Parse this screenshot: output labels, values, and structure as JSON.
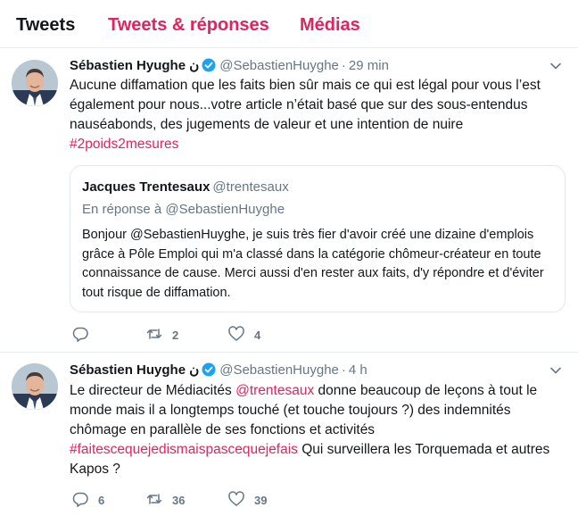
{
  "tabs": [
    "Tweets",
    "Tweets & réponses",
    "Médias"
  ],
  "colors": {
    "accent": "#e0245e",
    "verified": "#1da1f2",
    "muted": "#657786"
  },
  "tweets": [
    {
      "name": "Sébastien Hyughe",
      "name_suffix": " ن",
      "handle": "@SebastienHuyghe",
      "sep": "·",
      "time": "29 min",
      "lines": [
        "Aucune diffamation que les faits bien sûr mais ce qui est légal pour vous l’est",
        "également pour nous...votre article n’était basé que sur des sous-entendus",
        "nauséabonds, des jugements de valeur et une intention de nuire"
      ],
      "hashtag": "#2poids2mesures",
      "quote": {
        "name": "Jacques Trentesaux",
        "handle": "@trentesaux",
        "reply_to": "En réponse à @SebastienHuyghe",
        "text": "Bonjour @SebastienHuyghe, je suis très fier d'avoir créé une dizaine d'emplois grâce à Pôle Emploi qui m'a classé dans la catégorie chômeur-créateur en toute connaissance de cause. Merci aussi d'en rester aux faits, d'y répondre et d'éviter tout risque de diffamation."
      },
      "reply_count": "",
      "retweet_count": "2",
      "like_count": "4"
    },
    {
      "name": "Sébastien Huyghe",
      "name_suffix": " ن",
      "handle": "@SebastienHuyghe",
      "sep": "·",
      "time": "4 h",
      "p1_before": "Le directeur de Médiacités ",
      "p1_mention": "@trentesaux",
      "p1_after": " donne beaucoup de leçons à tout le monde mais il a longtemps touché (et touche toujours ?) des indemnités chômage en parallèle de ses fonctions et activités",
      "p2_hashtag": "#faitescequejedismaispascequejefais",
      "p2_after": " Qui surveillera les Torquemada et autres Kapos ?",
      "reply_count": "6",
      "retweet_count": "36",
      "like_count": "39"
    }
  ]
}
